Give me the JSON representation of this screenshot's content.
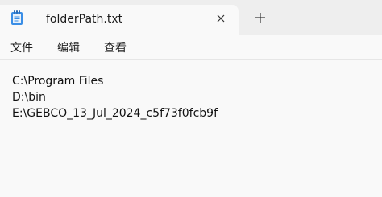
{
  "tab": {
    "title": "folderPath.txt"
  },
  "menu": {
    "items": [
      "文件",
      "编辑",
      "查看"
    ]
  },
  "editor": {
    "lines": [
      "C:\\Program Files",
      "D:\\bin",
      "E:\\GEBCO_13_Jul_2024_c5f73f0fcb9f"
    ]
  },
  "icons": {
    "app": "notepad-icon",
    "close": "close-icon",
    "new_tab": "plus-icon"
  },
  "colors": {
    "tabbar_bg": "#eeeeee",
    "window_bg": "#f9f9f9",
    "text": "#1b1b1b"
  }
}
